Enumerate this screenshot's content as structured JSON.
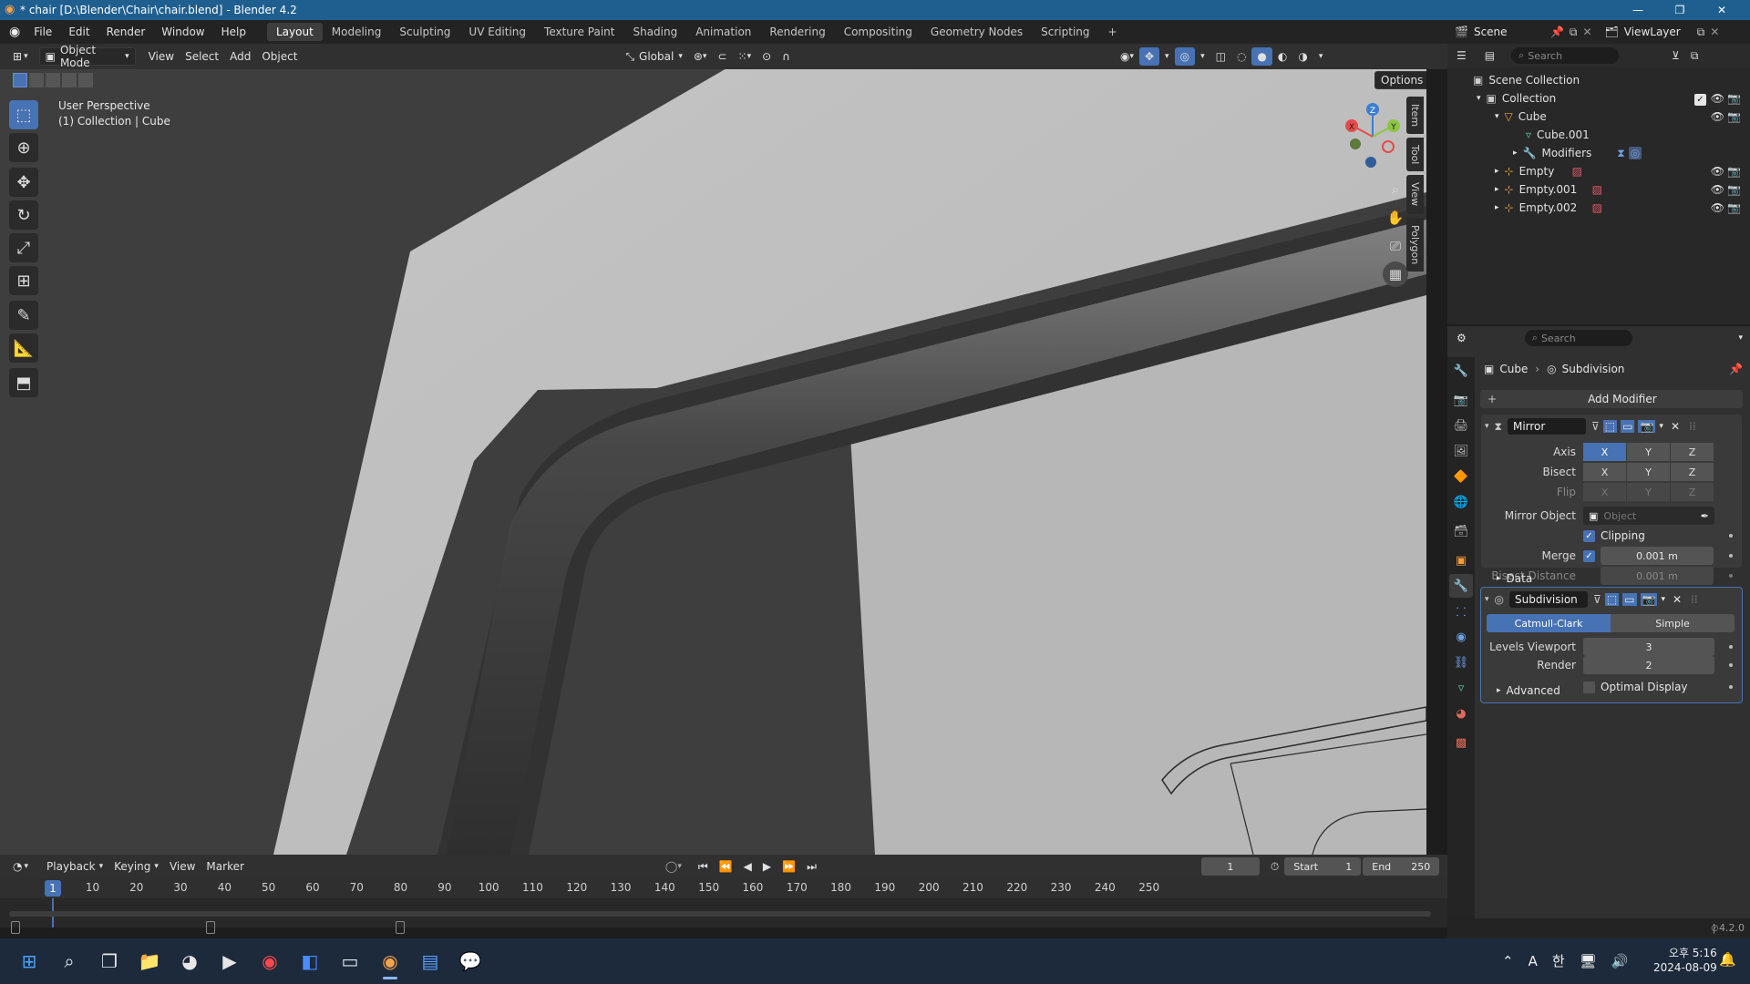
{
  "window": {
    "title": "* chair [D:\\Blender\\Chair\\chair.blend] - Blender 4.2",
    "minimize": "—",
    "maximize": "❐",
    "close": "✕"
  },
  "menu": {
    "items": [
      "File",
      "Edit",
      "Render",
      "Window",
      "Help"
    ],
    "workspaces": [
      "Layout",
      "Modeling",
      "Sculpting",
      "UV Editing",
      "Texture Paint",
      "Shading",
      "Animation",
      "Rendering",
      "Compositing",
      "Geometry Nodes",
      "Scripting"
    ],
    "active_workspace": "Layout",
    "add_tab": "+"
  },
  "viewport_header": {
    "mode": "Object Mode",
    "menus": [
      "View",
      "Select",
      "Add",
      "Object"
    ],
    "orientation": "Global",
    "options": "Options"
  },
  "viewport": {
    "perspective_label": "User Perspective",
    "collection_label": "(1) Collection | Cube",
    "side_tabs": [
      "Item",
      "Tool",
      "View",
      "Polygon"
    ],
    "gizmo": {
      "x": "X",
      "y": "Y",
      "z": "Z"
    }
  },
  "toolbar": {
    "tools": [
      "select-box",
      "cursor",
      "move",
      "rotate",
      "scale",
      "transform",
      "annotate",
      "measure",
      "add-cube"
    ]
  },
  "outliner": {
    "scene": "Scene",
    "view_layer": "ViewLayer",
    "search_placeholder": "Search",
    "scene_collection": "Scene Collection",
    "rows": [
      {
        "label": "Collection",
        "indent": 1
      },
      {
        "label": "Cube",
        "indent": 2
      },
      {
        "label": "Cube.001",
        "indent": 3
      },
      {
        "label": "Modifiers",
        "indent": 3
      },
      {
        "label": "Empty",
        "indent": 2
      },
      {
        "label": "Empty.001",
        "indent": 2
      },
      {
        "label": "Empty.002",
        "indent": 2
      }
    ]
  },
  "properties": {
    "search_placeholder": "Search",
    "breadcrumb_object": "Cube",
    "breadcrumb_modifier": "Subdivision",
    "add_modifier": "Add Modifier",
    "mirror": {
      "name": "Mirror",
      "axis_label": "Axis",
      "bisect_label": "Bisect",
      "flip_label": "Flip",
      "axes": [
        "X",
        "Y",
        "Z"
      ],
      "mirror_object_label": "Mirror Object",
      "mirror_object_placeholder": "Object",
      "clipping_label": "Clipping",
      "merge_label": "Merge",
      "merge_value": "0.001 m",
      "bisect_distance_label": "Bisect Distance",
      "bisect_distance_value": "0.001 m",
      "data_label": "Data"
    },
    "subdivision": {
      "name": "Subdivision",
      "catmull": "Catmull-Clark",
      "simple": "Simple",
      "levels_viewport_label": "Levels Viewport",
      "levels_viewport_value": "3",
      "render_label": "Render",
      "render_value": "2",
      "optimal_label": "Optimal Display",
      "advanced_label": "Advanced"
    },
    "version": "4.2.0"
  },
  "timeline": {
    "menus": [
      "Playback",
      "Keying",
      "View",
      "Marker"
    ],
    "current_frame": "1",
    "start_label": "Start",
    "start_value": "1",
    "end_label": "End",
    "end_value": "250",
    "ticks": [
      "10",
      "20",
      "30",
      "40",
      "50",
      "60",
      "70",
      "80",
      "90",
      "100",
      "110",
      "120",
      "130",
      "140",
      "150",
      "160",
      "170",
      "180",
      "190",
      "200",
      "210",
      "220",
      "230",
      "240",
      "250"
    ],
    "playhead": "1"
  },
  "taskbar": {
    "time": "오후 5:16",
    "date": "2024-08-09",
    "ime": "A",
    "ime2": "한"
  }
}
